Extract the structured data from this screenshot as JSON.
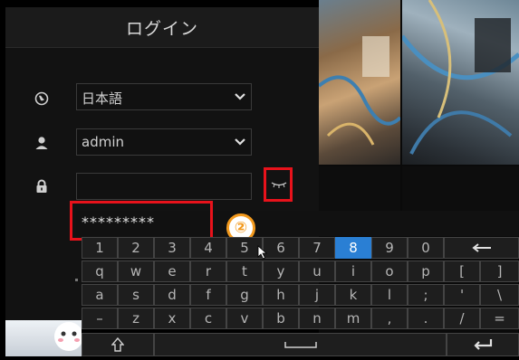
{
  "login": {
    "title": "ログイン",
    "language": "日本語",
    "username": "admin",
    "password_masked": "*********"
  },
  "annotation": {
    "step": "②",
    "highlight_color": "#e8121b",
    "badge_color": "#f39a1e"
  },
  "keyboard": {
    "active_key": "8",
    "rows": [
      [
        "1",
        "2",
        "3",
        "4",
        "5",
        "6",
        "7",
        "8",
        "9",
        "0",
        "←"
      ],
      [
        "q",
        "w",
        "e",
        "r",
        "t",
        "y",
        "u",
        "i",
        "o",
        "p",
        "[",
        "]"
      ],
      [
        "a",
        "s",
        "d",
        "f",
        "g",
        "h",
        "j",
        "k",
        "l",
        ";",
        "'",
        "\\"
      ],
      [
        "–",
        "z",
        "x",
        "c",
        "v",
        "b",
        "n",
        "m",
        ",",
        ".",
        "/",
        "="
      ],
      [
        "⇧",
        "space",
        "↵"
      ]
    ]
  },
  "icons": {
    "language": "globe-icon",
    "user": "user-icon",
    "password": "lock-icon",
    "dropdown": "chevron-down-icon",
    "show_password": "eye-closed-icon",
    "shift": "shift-icon",
    "backspace": "backspace-icon",
    "enter": "enter-icon"
  }
}
